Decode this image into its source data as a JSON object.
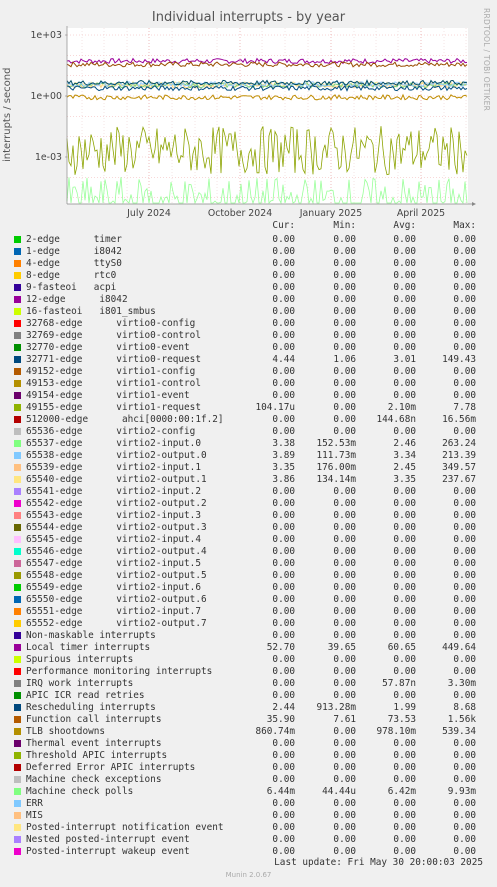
{
  "chart_data": {
    "type": "line",
    "title": "Individual interrupts - by year",
    "ylabel": "interrupts / second",
    "ylog": true,
    "y_ticks": [
      "1e+03",
      "1e+00",
      "1e-03"
    ],
    "x_ticks": [
      "July 2024",
      "October 2024",
      "January 2025",
      "April 2025"
    ],
    "side_label": "RRDTOOL / TOBI OETIKER",
    "series": [
      {
        "name": "Local timer interrupts",
        "color": "#990099",
        "level": 52.7
      },
      {
        "name": "Function call interrupts",
        "color": "#994c00",
        "level": 35.9
      },
      {
        "name": "65539-edge virtio2-input.1",
        "color": "#ffd27f",
        "level": 3.35
      },
      {
        "name": "65540-edge virtio2-output.1",
        "color": "#ffe599",
        "level": 3.86
      },
      {
        "name": "65537-edge virtio2-input.0",
        "color": "#7fd27f",
        "level": 3.38
      },
      {
        "name": "65538-edge virtio2-output.0",
        "color": "#99ccff",
        "level": 3.89
      },
      {
        "name": "32771-edge virtio0-request",
        "color": "#004c66",
        "level": 4.44
      },
      {
        "name": "Rescheduling interrupts",
        "color": "#004c80",
        "level": 2.44
      },
      {
        "name": "TLB shootdowns",
        "color": "#bf8c00",
        "level": 0.86
      },
      {
        "name": "49155-edge virtio1-request",
        "color": "#8ca300",
        "level": 0.0021
      },
      {
        "name": "Machine check polls",
        "color": "#99ff99",
        "level": 6.4e-06
      }
    ]
  },
  "legend": {
    "headers": {
      "cur": "Cur:",
      "min": "Min:",
      "avg": "Avg:",
      "max": "Max:"
    },
    "rows": [
      {
        "color": "#00cc00",
        "label": "2-edge      timer",
        "cur": "0.00",
        "min": "0.00",
        "avg": "0.00",
        "max": "0.00"
      },
      {
        "color": "#0066b3",
        "label": "1-edge      i8042",
        "cur": "0.00",
        "min": "0.00",
        "avg": "0.00",
        "max": "0.00"
      },
      {
        "color": "#ff8000",
        "label": "4-edge      ttyS0",
        "cur": "0.00",
        "min": "0.00",
        "avg": "0.00",
        "max": "0.00"
      },
      {
        "color": "#ffcc00",
        "label": "8-edge      rtc0",
        "cur": "0.00",
        "min": "0.00",
        "avg": "0.00",
        "max": "0.00"
      },
      {
        "color": "#330099",
        "label": "9-fasteoi   acpi",
        "cur": "0.00",
        "min": "0.00",
        "avg": "0.00",
        "max": "0.00"
      },
      {
        "color": "#990099",
        "label": "12-edge      i8042",
        "cur": "0.00",
        "min": "0.00",
        "avg": "0.00",
        "max": "0.00"
      },
      {
        "color": "#ccff00",
        "label": "16-fasteoi   i801_smbus",
        "cur": "0.00",
        "min": "0.00",
        "avg": "0.00",
        "max": "0.00"
      },
      {
        "color": "#ff0000",
        "label": "32768-edge      virtio0-config",
        "cur": "0.00",
        "min": "0.00",
        "avg": "0.00",
        "max": "0.00"
      },
      {
        "color": "#808080",
        "label": "32769-edge      virtio0-control",
        "cur": "0.00",
        "min": "0.00",
        "avg": "0.00",
        "max": "0.00"
      },
      {
        "color": "#008f00",
        "label": "32770-edge      virtio0-event",
        "cur": "0.00",
        "min": "0.00",
        "avg": "0.00",
        "max": "0.00"
      },
      {
        "color": "#00487d",
        "label": "32771-edge      virtio0-request",
        "cur": "4.44",
        "min": "1.06",
        "avg": "3.01",
        "max": "149.43"
      },
      {
        "color": "#b35a00",
        "label": "49152-edge      virtio1-config",
        "cur": "0.00",
        "min": "0.00",
        "avg": "0.00",
        "max": "0.00"
      },
      {
        "color": "#b38f00",
        "label": "49153-edge      virtio1-control",
        "cur": "0.00",
        "min": "0.00",
        "avg": "0.00",
        "max": "0.00"
      },
      {
        "color": "#6b006b",
        "label": "49154-edge      virtio1-event",
        "cur": "0.00",
        "min": "0.00",
        "avg": "0.00",
        "max": "0.00"
      },
      {
        "color": "#8fb300",
        "label": "49155-edge      virtio1-request",
        "cur": "104.17u",
        "min": "0.00",
        "avg": "2.10m",
        "max": "7.78"
      },
      {
        "color": "#b30000",
        "label": "512000-edge      ahci[0000:00:1f.2]",
        "cur": "0.00",
        "min": "0.00",
        "avg": "144.68n",
        "max": "16.56m"
      },
      {
        "color": "#bebebe",
        "label": "65536-edge      virtio2-config",
        "cur": "0.00",
        "min": "0.00",
        "avg": "0.00",
        "max": "0.00"
      },
      {
        "color": "#80ff80",
        "label": "65537-edge      virtio2-input.0",
        "cur": "3.38",
        "min": "152.53m",
        "avg": "2.46",
        "max": "263.24"
      },
      {
        "color": "#80c9ff",
        "label": "65538-edge      virtio2-output.0",
        "cur": "3.89",
        "min": "111.73m",
        "avg": "3.34",
        "max": "213.39"
      },
      {
        "color": "#ffc080",
        "label": "65539-edge      virtio2-input.1",
        "cur": "3.35",
        "min": "176.00m",
        "avg": "2.45",
        "max": "349.57"
      },
      {
        "color": "#ffe680",
        "label": "65540-edge      virtio2-output.1",
        "cur": "3.86",
        "min": "134.14m",
        "avg": "3.35",
        "max": "237.67"
      },
      {
        "color": "#aa80ff",
        "label": "65541-edge      virtio2-input.2",
        "cur": "0.00",
        "min": "0.00",
        "avg": "0.00",
        "max": "0.00"
      },
      {
        "color": "#ee00cc",
        "label": "65542-edge      virtio2-output.2",
        "cur": "0.00",
        "min": "0.00",
        "avg": "0.00",
        "max": "0.00"
      },
      {
        "color": "#ff8080",
        "label": "65543-edge      virtio2-input.3",
        "cur": "0.00",
        "min": "0.00",
        "avg": "0.00",
        "max": "0.00"
      },
      {
        "color": "#666600",
        "label": "65544-edge      virtio2-output.3",
        "cur": "0.00",
        "min": "0.00",
        "avg": "0.00",
        "max": "0.00"
      },
      {
        "color": "#ffbfff",
        "label": "65545-edge      virtio2-input.4",
        "cur": "0.00",
        "min": "0.00",
        "avg": "0.00",
        "max": "0.00"
      },
      {
        "color": "#00ffcc",
        "label": "65546-edge      virtio2-output.4",
        "cur": "0.00",
        "min": "0.00",
        "avg": "0.00",
        "max": "0.00"
      },
      {
        "color": "#cc6699",
        "label": "65547-edge      virtio2-input.5",
        "cur": "0.00",
        "min": "0.00",
        "avg": "0.00",
        "max": "0.00"
      },
      {
        "color": "#999900",
        "label": "65548-edge      virtio2-output.5",
        "cur": "0.00",
        "min": "0.00",
        "avg": "0.00",
        "max": "0.00"
      },
      {
        "color": "#00cc00",
        "label": "65549-edge      virtio2-input.6",
        "cur": "0.00",
        "min": "0.00",
        "avg": "0.00",
        "max": "0.00"
      },
      {
        "color": "#0066b3",
        "label": "65550-edge      virtio2-output.6",
        "cur": "0.00",
        "min": "0.00",
        "avg": "0.00",
        "max": "0.00"
      },
      {
        "color": "#ff8000",
        "label": "65551-edge      virtio2-input.7",
        "cur": "0.00",
        "min": "0.00",
        "avg": "0.00",
        "max": "0.00"
      },
      {
        "color": "#ffcc00",
        "label": "65552-edge      virtio2-output.7",
        "cur": "0.00",
        "min": "0.00",
        "avg": "0.00",
        "max": "0.00"
      },
      {
        "color": "#330099",
        "label": "Non-maskable interrupts",
        "cur": "0.00",
        "min": "0.00",
        "avg": "0.00",
        "max": "0.00"
      },
      {
        "color": "#990099",
        "label": "Local timer interrupts",
        "cur": "52.70",
        "min": "39.65",
        "avg": "60.65",
        "max": "449.64"
      },
      {
        "color": "#ccff00",
        "label": "Spurious interrupts",
        "cur": "0.00",
        "min": "0.00",
        "avg": "0.00",
        "max": "0.00"
      },
      {
        "color": "#ff0000",
        "label": "Performance monitoring interrupts",
        "cur": "0.00",
        "min": "0.00",
        "avg": "0.00",
        "max": "0.00"
      },
      {
        "color": "#808080",
        "label": "IRQ work interrupts",
        "cur": "0.00",
        "min": "0.00",
        "avg": "57.87n",
        "max": "3.30m"
      },
      {
        "color": "#008f00",
        "label": "APIC ICR read retries",
        "cur": "0.00",
        "min": "0.00",
        "avg": "0.00",
        "max": "0.00"
      },
      {
        "color": "#00487d",
        "label": "Rescheduling interrupts",
        "cur": "2.44",
        "min": "913.28m",
        "avg": "1.99",
        "max": "8.68"
      },
      {
        "color": "#b35a00",
        "label": "Function call interrupts",
        "cur": "35.90",
        "min": "7.61",
        "avg": "73.53",
        "max": "1.56k"
      },
      {
        "color": "#b38f00",
        "label": "TLB shootdowns",
        "cur": "860.74m",
        "min": "0.00",
        "avg": "978.10m",
        "max": "539.34"
      },
      {
        "color": "#6b006b",
        "label": "Thermal event interrupts",
        "cur": "0.00",
        "min": "0.00",
        "avg": "0.00",
        "max": "0.00"
      },
      {
        "color": "#8fb300",
        "label": "Threshold APIC interrupts",
        "cur": "0.00",
        "min": "0.00",
        "avg": "0.00",
        "max": "0.00"
      },
      {
        "color": "#b30000",
        "label": "Deferred Error APIC interrupts",
        "cur": "0.00",
        "min": "0.00",
        "avg": "0.00",
        "max": "0.00"
      },
      {
        "color": "#bebebe",
        "label": "Machine check exceptions",
        "cur": "0.00",
        "min": "0.00",
        "avg": "0.00",
        "max": "0.00"
      },
      {
        "color": "#80ff80",
        "label": "Machine check polls",
        "cur": "6.44m",
        "min": "44.44u",
        "avg": "6.42m",
        "max": "9.93m"
      },
      {
        "color": "#80c9ff",
        "label": "ERR",
        "cur": "0.00",
        "min": "0.00",
        "avg": "0.00",
        "max": "0.00"
      },
      {
        "color": "#ffc080",
        "label": "MIS",
        "cur": "0.00",
        "min": "0.00",
        "avg": "0.00",
        "max": "0.00"
      },
      {
        "color": "#ffe680",
        "label": "Posted-interrupt notification event",
        "cur": "0.00",
        "min": "0.00",
        "avg": "0.00",
        "max": "0.00"
      },
      {
        "color": "#aa80ff",
        "label": "Nested posted-interrupt event",
        "cur": "0.00",
        "min": "0.00",
        "avg": "0.00",
        "max": "0.00"
      },
      {
        "color": "#ee00cc",
        "label": "Posted-interrupt wakeup event",
        "cur": "0.00",
        "min": "0.00",
        "avg": "0.00",
        "max": "0.00"
      }
    ]
  },
  "last_update": "Last update: Fri May 30 20:00:03 2025",
  "footer": "Munin 2.0.67"
}
